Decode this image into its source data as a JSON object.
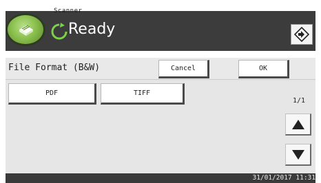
{
  "header": {
    "app_name": "Scanner",
    "status_text": "Ready",
    "status_icon": "ready-refresh-icon",
    "login_icon": "login-door-icon"
  },
  "toolbar": {
    "title": "File Format (B&W)",
    "cancel_label": "Cancel",
    "ok_label": "OK"
  },
  "options": [
    {
      "label": "PDF"
    },
    {
      "label": "TIFF"
    }
  ],
  "pagination": {
    "page_indicator": "1/1",
    "up_icon": "triangle-up-icon",
    "down_icon": "triangle-down-icon"
  },
  "footer": {
    "datetime": "31/01/2017 11:31"
  },
  "colors": {
    "header_bg": "#3c3c3c",
    "content_bg": "#e6e6e6",
    "accent_green": "#8cc04e"
  }
}
